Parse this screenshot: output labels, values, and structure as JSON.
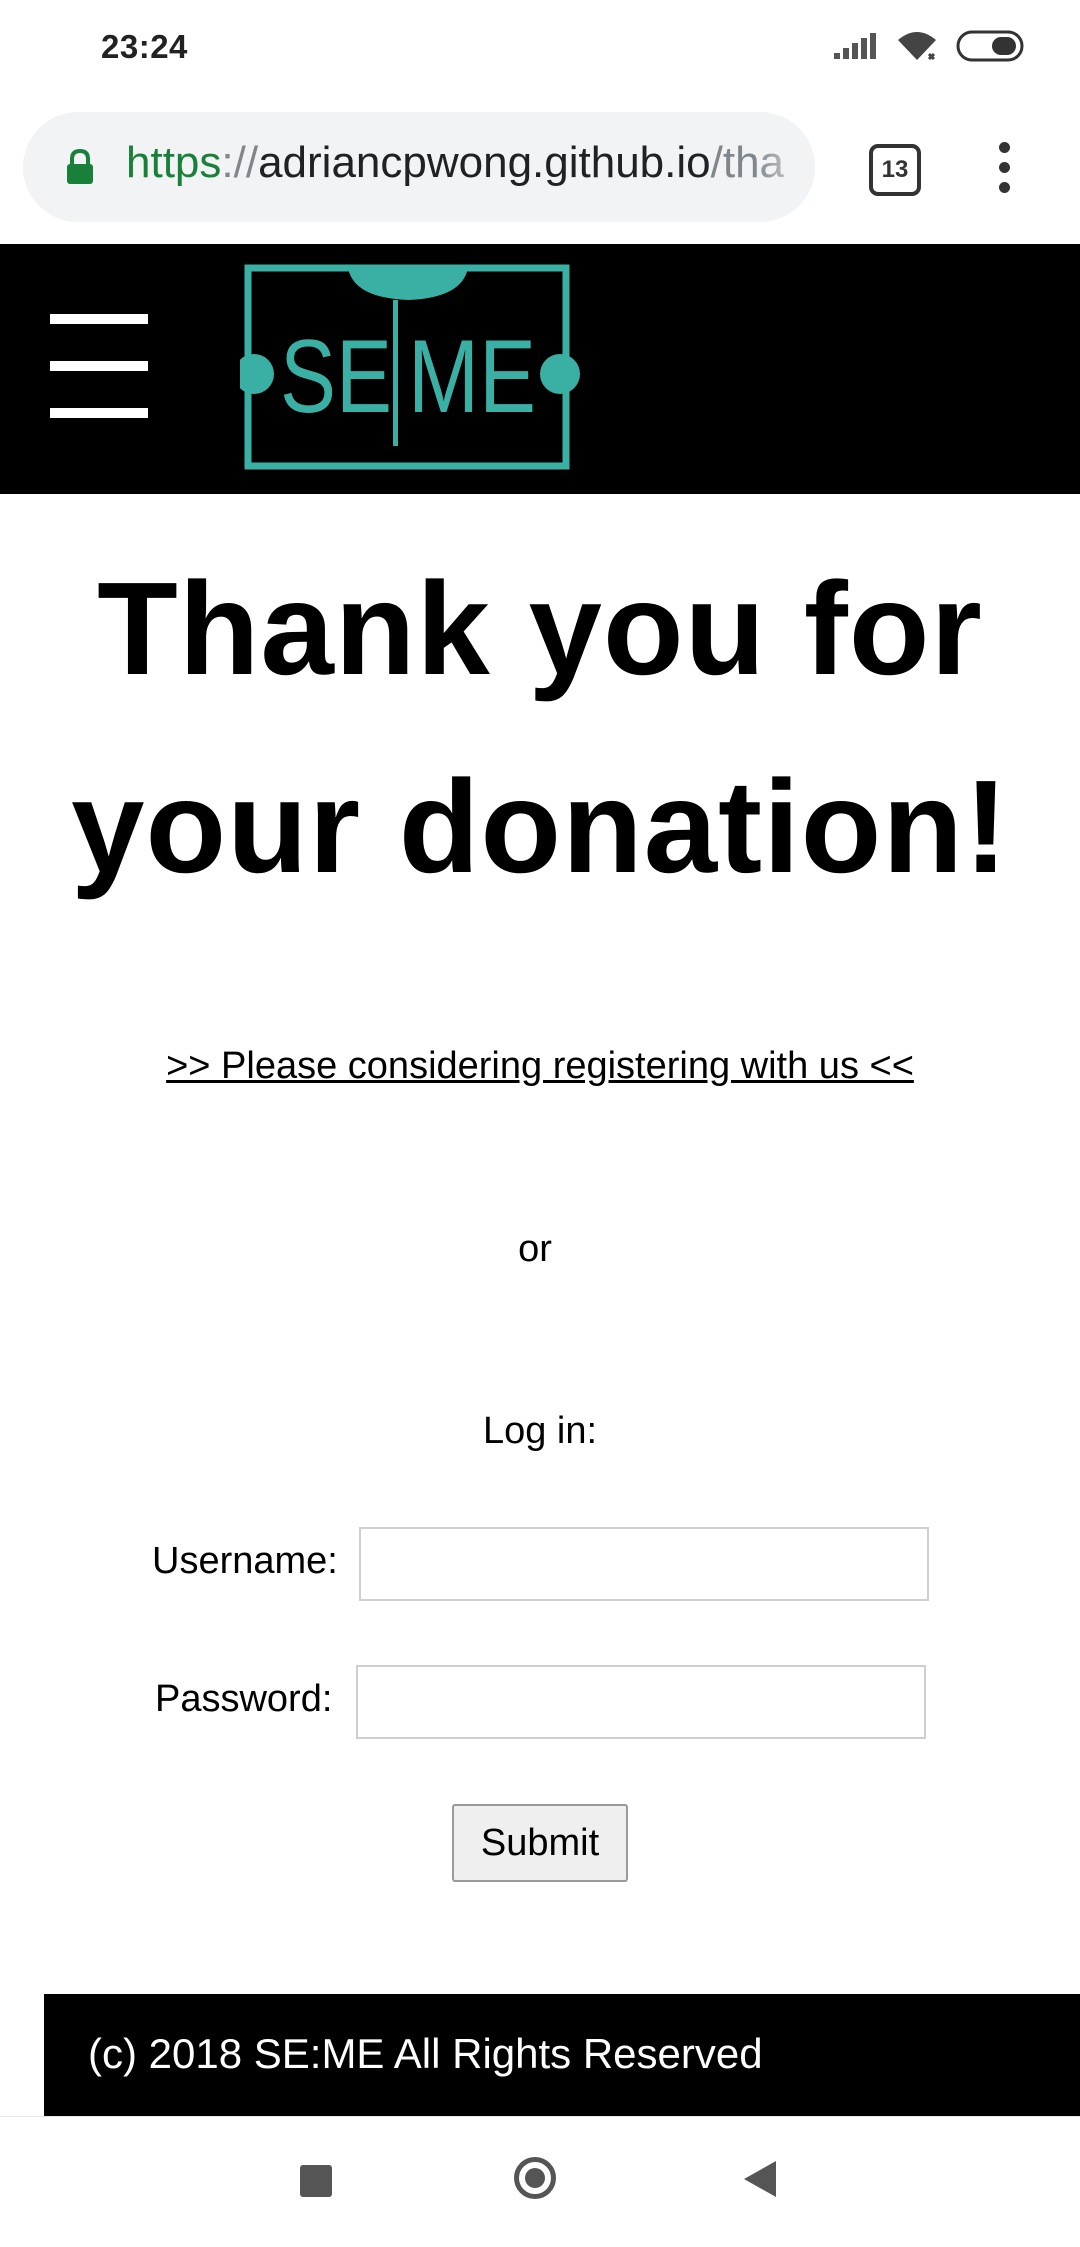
{
  "status_bar": {
    "time": "23:24",
    "icons": [
      "signal-icon",
      "wifi-icon",
      "battery-icon"
    ]
  },
  "browser": {
    "url_scheme": "https",
    "url_separator": "://",
    "url_host": "adriancpwong.github.io",
    "url_path": "/tha",
    "tab_count": "13",
    "colors": {
      "secure_green": "#188038",
      "pill_bg": "#f1f3f4"
    }
  },
  "header": {
    "logo_text": "SE|ME",
    "logo_color": "#3ab0a4"
  },
  "main": {
    "heading_line1": "Thank you for",
    "heading_line2": "your donation!",
    "register_link": ">> Please considering registering with us <<",
    "or_text": "or",
    "login_label": "Log in:",
    "username_label": "Username:",
    "username_value": "",
    "password_label": "Password:",
    "password_value": "",
    "submit_label": "Submit"
  },
  "footer": {
    "text": "(c) 2018 SE:ME All Rights Reserved"
  }
}
